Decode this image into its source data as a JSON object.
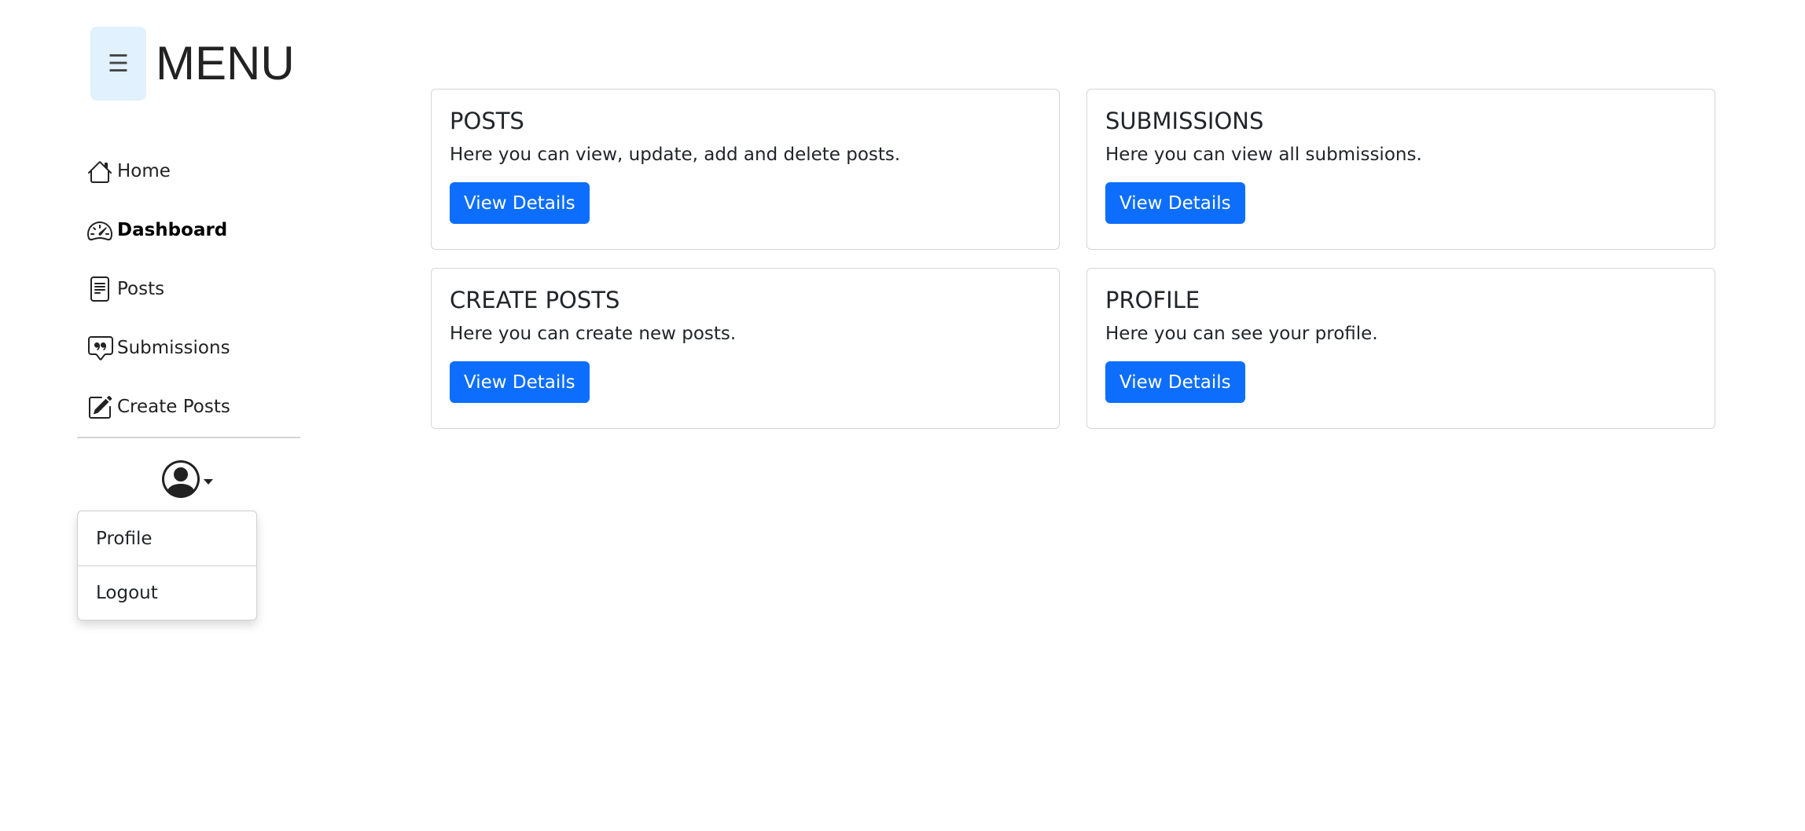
{
  "sidebar": {
    "menu_icon": "☰",
    "menu_title": "MENU",
    "items": [
      {
        "label": "Home",
        "icon": "house-icon"
      },
      {
        "label": "Dashboard",
        "icon": "speedometer-icon",
        "active": true
      },
      {
        "label": "Posts",
        "icon": "file-text-icon"
      },
      {
        "label": "Submissions",
        "icon": "chat-quote-icon"
      },
      {
        "label": "Create Posts",
        "icon": "pencil-square-icon"
      }
    ],
    "user_menu": {
      "icon": "person-circle-icon",
      "items": [
        {
          "label": "Profile"
        },
        {
          "label": "Logout"
        }
      ]
    }
  },
  "cards": [
    {
      "title": "POSTS",
      "text": "Here you can view, update, add and delete posts.",
      "button": "View Details"
    },
    {
      "title": "SUBMISSIONS",
      "text": "Here you can view all submissions.",
      "button": "View Details"
    },
    {
      "title": "CREATE POSTS",
      "text": "Here you can create new posts.",
      "button": "View Details"
    },
    {
      "title": "PROFILE",
      "text": "Here you can see your profile.",
      "button": "View Details"
    }
  ],
  "colors": {
    "primary": "#0d6efd",
    "toggle_bg": "#e1f1fd"
  }
}
